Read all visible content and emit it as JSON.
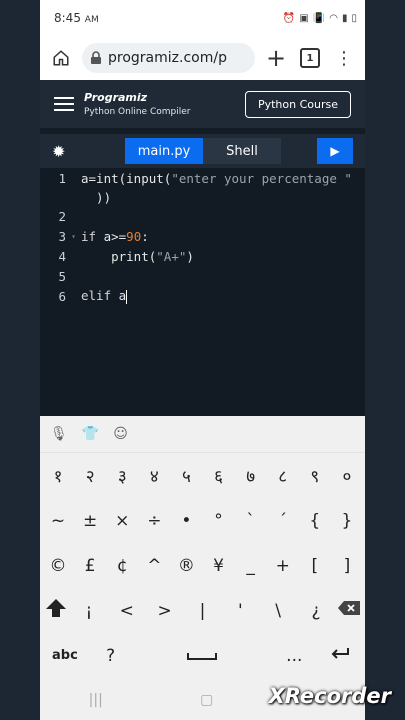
{
  "status": {
    "time": "8:45",
    "ampm": "AM"
  },
  "browser": {
    "url": "programiz.com/p",
    "tab_count": "1"
  },
  "header": {
    "logo": "Programiz",
    "subtitle": "Python Online Compiler",
    "course_button": "Python Course"
  },
  "toolbar": {
    "tab_main": "main.py",
    "tab_shell": "Shell"
  },
  "editor": {
    "lines": [
      {
        "n": "1",
        "text": "a=int(input(",
        "str": "\"enter your percentage \""
      },
      {
        "wrap": "  ))"
      },
      {
        "n": "2"
      },
      {
        "n": "3",
        "kw": "if",
        "expr": "a>=",
        "num": "90",
        "rest": ":"
      },
      {
        "n": "4",
        "indent": "    ",
        "call": "print(",
        "str": "\"A+\"",
        "close": ")"
      },
      {
        "n": "5"
      },
      {
        "n": "6",
        "kw": "elif",
        "expr": " a"
      }
    ]
  },
  "keyboard": {
    "row1": [
      "१",
      "२",
      "३",
      "४",
      "५",
      "६",
      "७",
      "८",
      "९",
      "०"
    ],
    "row2": [
      "~",
      "±",
      "×",
      "÷",
      "•",
      "°",
      "`",
      "´",
      "{",
      "}"
    ],
    "row3": [
      "©",
      "£",
      "¢",
      "^",
      "®",
      "¥",
      "_",
      "+",
      "[",
      "]"
    ],
    "row4": [
      "¡",
      "<",
      ">",
      "|",
      "'",
      "\\",
      "¿"
    ],
    "abc": "abc",
    "question": "?",
    "ellipsis": "..."
  },
  "watermark": "XRecorder"
}
